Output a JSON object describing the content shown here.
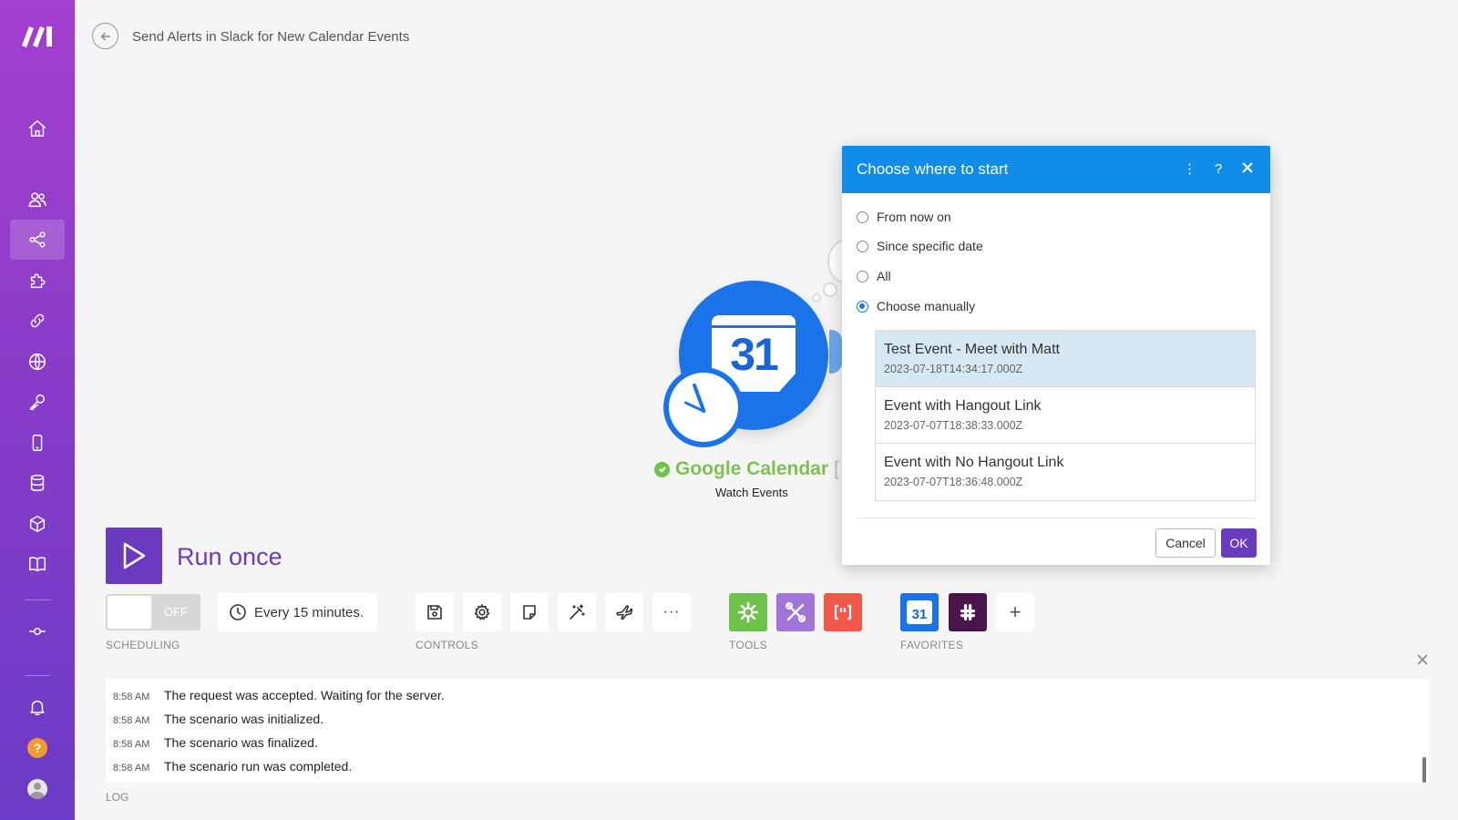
{
  "header": {
    "title": "Send Alerts in Slack for New Calendar Events"
  },
  "sidebar": {
    "items": [
      {
        "icon": "home-icon"
      },
      {
        "icon": "team-icon"
      },
      {
        "icon": "scenarios-icon",
        "active": true
      },
      {
        "icon": "puzzle-icon"
      },
      {
        "icon": "link-icon"
      },
      {
        "icon": "globe-icon"
      },
      {
        "icon": "key-icon"
      },
      {
        "icon": "device-icon"
      },
      {
        "icon": "database-icon"
      },
      {
        "icon": "box-icon"
      },
      {
        "icon": "book-icon"
      },
      {
        "icon": "commit-icon"
      },
      {
        "icon": "bell-icon"
      },
      {
        "icon": "help-icon"
      },
      {
        "icon": "avatar-icon"
      }
    ],
    "help_glyph": "?"
  },
  "module": {
    "app_name": "Google Calendar",
    "action": "Watch Events",
    "calendar_number": "31",
    "bracket": "["
  },
  "run": {
    "label": "Run once"
  },
  "toolbar": {
    "scheduling_toggle": "OFF",
    "schedule_text": "Every 15 minutes.",
    "more_label": "···",
    "add_label": "+",
    "favorite_calendar_number": "31",
    "sections": {
      "scheduling": "SCHEDULING",
      "controls": "CONTROLS",
      "tools": "TOOLS",
      "favorites": "FAVORITES"
    }
  },
  "log": {
    "label": "LOG",
    "entries": [
      {
        "time": "8:58 AM",
        "message": "The request was accepted. Waiting for the server."
      },
      {
        "time": "8:58 AM",
        "message": "The scenario was initialized."
      },
      {
        "time": "8:58 AM",
        "message": "The scenario was finalized."
      },
      {
        "time": "8:58 AM",
        "message": "The scenario run was completed."
      }
    ]
  },
  "dialog": {
    "title": "Choose where to start",
    "kebab": "⋮",
    "help": "?",
    "options": [
      {
        "label": "From now on",
        "checked": false
      },
      {
        "label": "Since specific date",
        "checked": false
      },
      {
        "label": "All",
        "checked": false
      },
      {
        "label": "Choose manually",
        "checked": true
      }
    ],
    "events": [
      {
        "title": "Test Event - Meet with Matt",
        "date": "2023-07-18T14:34:17.000Z",
        "selected": true
      },
      {
        "title": "Event with Hangout Link",
        "date": "2023-07-07T18:38:33.000Z",
        "selected": false
      },
      {
        "title": "Event with No Hangout Link",
        "date": "2023-07-07T18:36:48.000Z",
        "selected": false
      }
    ],
    "cancel_label": "Cancel",
    "ok_label": "OK"
  },
  "colors": {
    "accent": "#6a3bbf",
    "dialog_header": "#118ce8",
    "calendar_blue": "#1a73e8",
    "success_green": "#7cc24e",
    "selected_row": "#d6e8f3"
  }
}
